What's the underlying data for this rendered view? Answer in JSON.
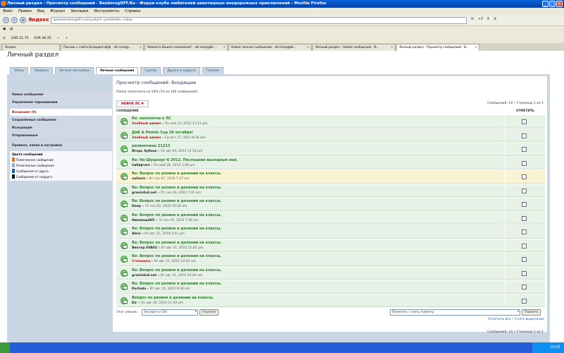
{
  "window": {
    "title": "Личный раздел - Просмотр сообщений - BezdorogOFF.Ru - Форум клуба любителей авантюрных внедорожных приключений - Mozilla Firefox"
  },
  "menu": [
    "Файл",
    "Правка",
    "Вид",
    "Журнал",
    "Закладки",
    "Инструменты",
    "Справка"
  ],
  "nav": {
    "yandex": "Яндекс",
    "url": "www.bezdorogoff.ru/ucp.php?i=pm&folder=inbox",
    "counters": [
      "+3",
      "6"
    ]
  },
  "toolbar": {
    "usd": "USD 31,73",
    "eur": "EUR 40,35"
  },
  "bookmarks": {
    "label": "Яндекс"
  },
  "tabs": [
    "",
    "Письмо с сайта Бездорогофф - zki-moo@...",
    "Немного Вашего внимания! - zki-moo@bk...",
    "Новое личное сообщение - zki-moo@bk...",
    "Личный раздел - Новое сообщение - B...",
    "Личный раздел - Просмотр сообщений - B..."
  ],
  "page": {
    "title": "Личный раздел",
    "tabs": [
      "Обзор",
      "Профиль",
      "Личные настройки",
      "Личные сообщения",
      "Группы",
      "Друзья и недруги",
      "Галерея"
    ]
  },
  "sidebar": {
    "items": [
      "Новое сообщение",
      "Управление черновиками"
    ],
    "folders": [
      "Входящие (9)",
      "Сохранённые сообщения",
      "Исходящие",
      "Отправленные"
    ],
    "rules": "Правила, папки и настройки",
    "legend_title": "Цвета сообщений",
    "legend": [
      {
        "label": "Помеченное сообщение",
        "color": "#e07a20"
      },
      {
        "label": "Отмеченные сообщения",
        "color": "#9ab0c8"
      },
      {
        "label": "Сообщение от друга",
        "color": "#1e5fa8"
      },
      {
        "label": "Сообщение от недруга",
        "color": "#111111"
      }
    ]
  },
  "main": {
    "heading": "Просмотр сообщений: Входящие",
    "folder_status": "Папка заполнена на 14% (14 из 100 сообщений)",
    "new_pm": "НОВОЕ ЛС",
    "pagination": "Сообщений: 14 • Страница 1 из 1",
    "col_message": "СООБЩЕНИЕ",
    "col_mark": "ОТМЕТИТЬ",
    "messages": [
      {
        "subject": "Re: непонятки в ЛС",
        "author": "Злобный админ",
        "date": "» Пн ноя 12, 2012 11:11 pm"
      },
      {
        "subject": "ДиБ & Pistols Cup 20 октября!",
        "author": "Злобный админ",
        "date": "» Ср окт 17, 2012 8:16 am"
      },
      {
        "subject": "резиночины 21213",
        "author": "Игорь Зубков",
        "date": "» Сб авг 04, 2012 12:54 pm"
      },
      {
        "subject": "Re: На Шушкор!-6 2012. Последние выходные мая.",
        "author": "Сибирчел",
        "date": "» Пн май 28, 2012 1:49 pm"
      },
      {
        "subject": "Re: Вопрос по резине и делении на классы.",
        "author": "nafania",
        "date": "» Вт сен 07, 2010 7:37 am"
      },
      {
        "subject": "Re: Вопрос по резине и делении на классы.",
        "author": "graniz4x4.net",
        "date": "» Пт сен 03, 2010 7:31 am"
      },
      {
        "subject": "Re: Вопрос по резине и делении на классы.",
        "author": "Deep",
        "date": "» Чт сен 02, 2010 10:24 am"
      },
      {
        "subject": "Re: Вопрос по резине и делении на классы.",
        "author": "Ниновод485",
        "date": "» Чт сен 02, 2010 7:39 am"
      },
      {
        "subject": "Re: Вопрос по резине и делении на классы.",
        "author": "Alexi",
        "date": "» Вт авг 31, 2010 2:01 pm"
      },
      {
        "subject": "Re: Вопрос по резине и делении на классы.",
        "author": "Виктор EVA02",
        "date": "» Вт авг 31, 2010 12:05 pm"
      },
      {
        "subject": "Re: Вопрос по резине и делении на классы.",
        "author": "Степашка",
        "date": "» Вт авг 31, 2010 10:55 am"
      },
      {
        "subject": "Re: Вопрос по резине и делении на классы.",
        "author": "graniz4x4.net",
        "date": "» Вт авг 31, 2010 10:44 am"
      },
      {
        "subject": "Re: Вопрос по резине и делении на классы.",
        "author": "Portada",
        "date": "» Вт авг 31, 2010 9:34 am"
      },
      {
        "subject": "Вопрос по резине и делении на классы.",
        "author": "Kir",
        "date": "» Пн авг 30, 2010 11:49 pm"
      }
    ],
    "this_list": "Этот список:",
    "export_value": "Экспорт в CSV",
    "go": "Перейти",
    "mark_value": "Пометить / снять пометку",
    "mark_all": "Отметить все • Снять выделение",
    "pagination_bottom": "Сообщений: 14 • Страница 1 из 1"
  },
  "taskbar": {
    "time": "15:03"
  }
}
